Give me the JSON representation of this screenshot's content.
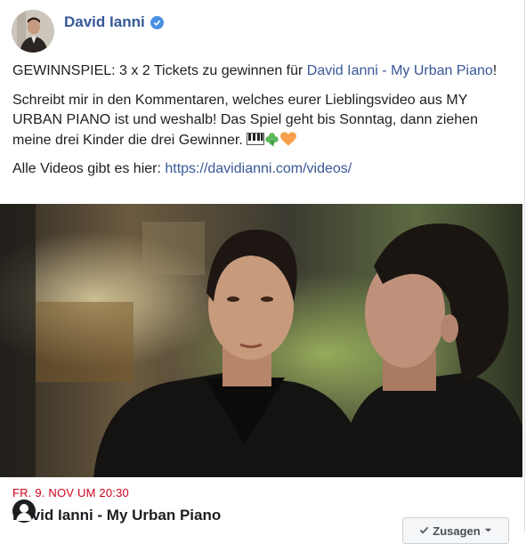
{
  "post": {
    "author": "David Ianni",
    "line1_prefix": "GEWINNSPIEL: 3 x 2 Tickets zu gewinnen für ",
    "line1_link": "David Ianni - My Urban Piano",
    "line1_suffix": "!",
    "paragraph2": "Schreibt mir in den Kommentaren, welches eurer Lieblingsvideo aus MY URBAN PIANO ist und weshalb! Das Spiel geht bis Sonntag, dann ziehen meine drei Kinder die drei Gewinner.",
    "line3_prefix": "Alle Videos gibt es hier: ",
    "line3_link": "https://davidianni.com/videos/"
  },
  "event": {
    "date": "FR. 9. NOV UM 20:30",
    "title": "David Ianni - My Urban Piano",
    "rsvp_label": "Zusagen"
  },
  "icons": [
    "verified-badge-icon",
    "piano-emoji-icon",
    "clover-emoji-icon",
    "orange-heart-emoji-icon",
    "chevron-down-icon",
    "check-icon"
  ],
  "colors": {
    "link": "#385898",
    "event_date": "#d0021b",
    "verified": "#4a90e2"
  }
}
